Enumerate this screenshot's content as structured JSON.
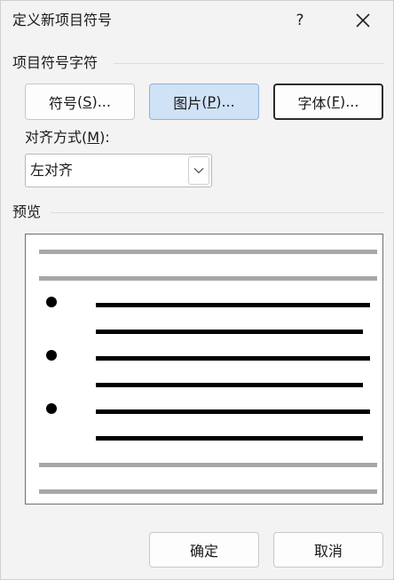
{
  "window": {
    "title": "定义新项目符号",
    "help_label": "?"
  },
  "bullet_char_section": {
    "label": "项目符号字符",
    "symbol_button": {
      "text": "符号",
      "mnemonic": "S",
      "suffix": "..."
    },
    "picture_button": {
      "text": "图片",
      "mnemonic": "P",
      "suffix": "..."
    },
    "font_button": {
      "text": "字体",
      "mnemonic": "F",
      "suffix": "..."
    }
  },
  "alignment": {
    "label": "对齐方式",
    "mnemonic": "M",
    "suffix": ":",
    "selected": "左对齐"
  },
  "preview_section": {
    "label": "预览",
    "bullet_count": 3
  },
  "footer": {
    "ok_label": "确定",
    "cancel_label": "取消"
  },
  "colors": {
    "dialog_bg": "#f3f3f3",
    "selected_button_bg": "#cfe2f6",
    "preview_gray_line": "#a7a7a7",
    "preview_black_line": "#000000"
  }
}
